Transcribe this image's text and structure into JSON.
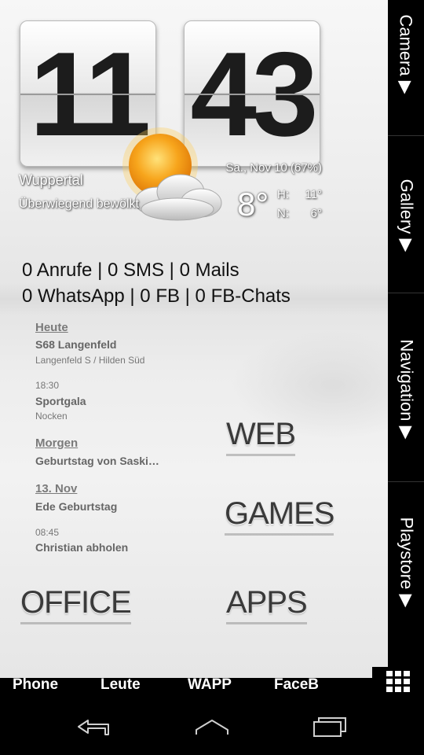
{
  "clock": {
    "hours": "11",
    "minutes": "43"
  },
  "weather": {
    "city": "Wuppertal",
    "condition": "Überwiegend bewölkt",
    "date_battery": "Sa., Nov 10 (67%)",
    "temperature": "8°",
    "high_label": "H:",
    "high_value": "11°",
    "low_label": "N:",
    "low_value": "6°",
    "icon": "sun-behind-cloud-icon"
  },
  "counters": {
    "line1": "0 Anrufe | 0 SMS | 0 Mails",
    "line2": "0 WhatsApp | 0 FB | 0 FB-Chats"
  },
  "agenda": {
    "day1": "Heute",
    "e1_title": "S68 Langenfeld",
    "e1_sub": "Langenfeld S / Hilden Süd",
    "e2_time": "18:30",
    "e2_title": "Sportgala",
    "e2_sub": "Nocken",
    "day2": "Morgen",
    "e3_title": "Geburtstag von Saski…",
    "day3": "13. Nov",
    "e4_title": "Ede Geburtstag",
    "e5_time": "08:45",
    "e5_title": "Christian abholen"
  },
  "shortcuts": {
    "web": "WEB",
    "games": "GAMES",
    "office": "OFFICE",
    "apps": "APPS"
  },
  "sidebar": {
    "camera": "Camera ▶",
    "gallery": "Gallery ▶",
    "navigation": "Navigation ▶",
    "playstore": "Playstore ▶"
  },
  "dock": {
    "phone": "Phone",
    "leute": "Leute",
    "wapp": "WAPP",
    "faceb": "FaceB",
    "grid_icon": "app-drawer-grid-icon"
  },
  "navbar": {
    "back_icon": "back-icon",
    "home_icon": "home-icon",
    "recent_icon": "recent-apps-icon"
  },
  "colors": {
    "wallpaper": "#ececec",
    "text_dark": "#111111",
    "bars": "#000000",
    "sun": "#f6a21a"
  }
}
